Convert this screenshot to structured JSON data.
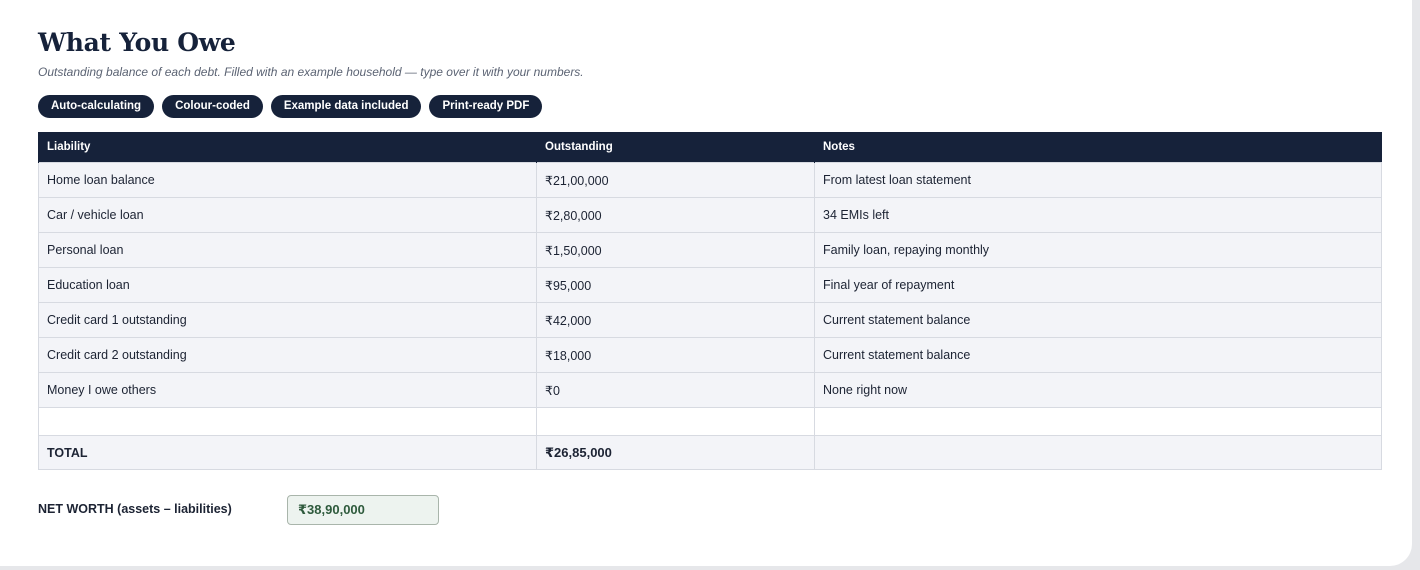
{
  "header": {
    "title": "What You Owe",
    "subtitle": "Outstanding balance of each debt. Filled with an example household — type over it with your numbers."
  },
  "tags": [
    "Auto-calculating",
    "Colour-coded",
    "Example data included",
    "Print-ready PDF"
  ],
  "table": {
    "columns": [
      "Liability",
      "Outstanding",
      "Notes"
    ],
    "rows": [
      {
        "liability": "Home loan balance",
        "outstanding": "₹21,00,000",
        "notes": "From latest loan statement"
      },
      {
        "liability": "Car / vehicle loan",
        "outstanding": "₹2,80,000",
        "notes": "34 EMIs left"
      },
      {
        "liability": "Personal loan",
        "outstanding": "₹1,50,000",
        "notes": "Family loan, repaying monthly"
      },
      {
        "liability": "Education loan",
        "outstanding": "₹95,000",
        "notes": "Final year of repayment"
      },
      {
        "liability": "Credit card 1 outstanding",
        "outstanding": "₹42,000",
        "notes": "Current statement balance"
      },
      {
        "liability": "Credit card 2 outstanding",
        "outstanding": "₹18,000",
        "notes": "Current statement balance"
      },
      {
        "liability": "Money I owe others",
        "outstanding": "₹0",
        "notes": "None right now"
      }
    ],
    "total": {
      "label": "TOTAL",
      "outstanding": "₹26,85,000"
    }
  },
  "net_worth": {
    "label": "NET WORTH (assets – liabilities)",
    "value": "₹38,90,000"
  },
  "colors": {
    "navy": "#16223a",
    "row_bg": "#f3f4f8",
    "net_worth_text": "#2e5a3c",
    "net_worth_bg": "#edf3ef"
  }
}
